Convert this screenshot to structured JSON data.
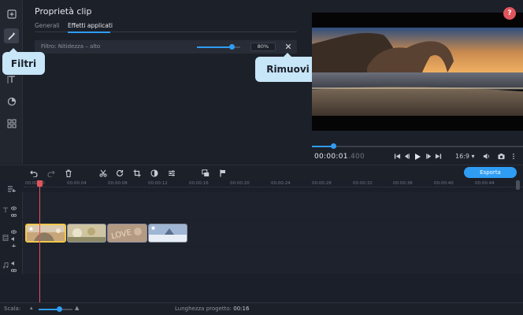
{
  "panel": {
    "title": "Proprietà clip",
    "tabs": [
      {
        "label": "Generali"
      },
      {
        "label": "Effetti applicati",
        "active": true
      }
    ],
    "filter": {
      "label": "Filtro: Nitidezza – alto",
      "value_text": "80%",
      "value": 0.8
    }
  },
  "callouts": {
    "filters": "Filtri",
    "remove": "Rimuovi"
  },
  "preview": {
    "timecode": "00:00:01",
    "timecode_ms": ".400",
    "aspect_ratio": "16:9 ▾",
    "progress": 0.1,
    "help": "?"
  },
  "toolbar": {
    "export_label": "Esporta"
  },
  "ruler": {
    "ticks": [
      "00:00:00",
      "00:00:04",
      "00:00:08",
      "00:00:12",
      "00:00:16",
      "00:00:20",
      "00:00:24",
      "00:00:28",
      "00:00:32",
      "00:00:36",
      "00:00:40",
      "00:00:44"
    ]
  },
  "status": {
    "scale_label": "Scala:",
    "project_length_label": "Lunghezza progetto:",
    "project_length_value": "00:16",
    "zoom": 0.6
  },
  "colors": {
    "accent": "#2f9df4",
    "playhead": "#e0555c",
    "selection": "#f2c94c",
    "callout": "#c7e6f8"
  },
  "icons": {
    "sidebar": [
      "import-icon",
      "magic-wand-icon",
      "filters-icon",
      "text-icon",
      "stickers-icon",
      "more-icon"
    ],
    "toolbar": [
      "undo-icon",
      "redo-icon",
      "delete-icon",
      "cut-icon",
      "rotate-icon",
      "crop-icon",
      "color-icon",
      "settings-icon",
      "overlay-icon",
      "marker-icon"
    ],
    "player": [
      "skip-start-icon",
      "prev-frame-icon",
      "play-icon",
      "next-frame-icon",
      "skip-end-icon",
      "volume-icon",
      "snapshot-icon",
      "more-vertical-icon"
    ]
  }
}
